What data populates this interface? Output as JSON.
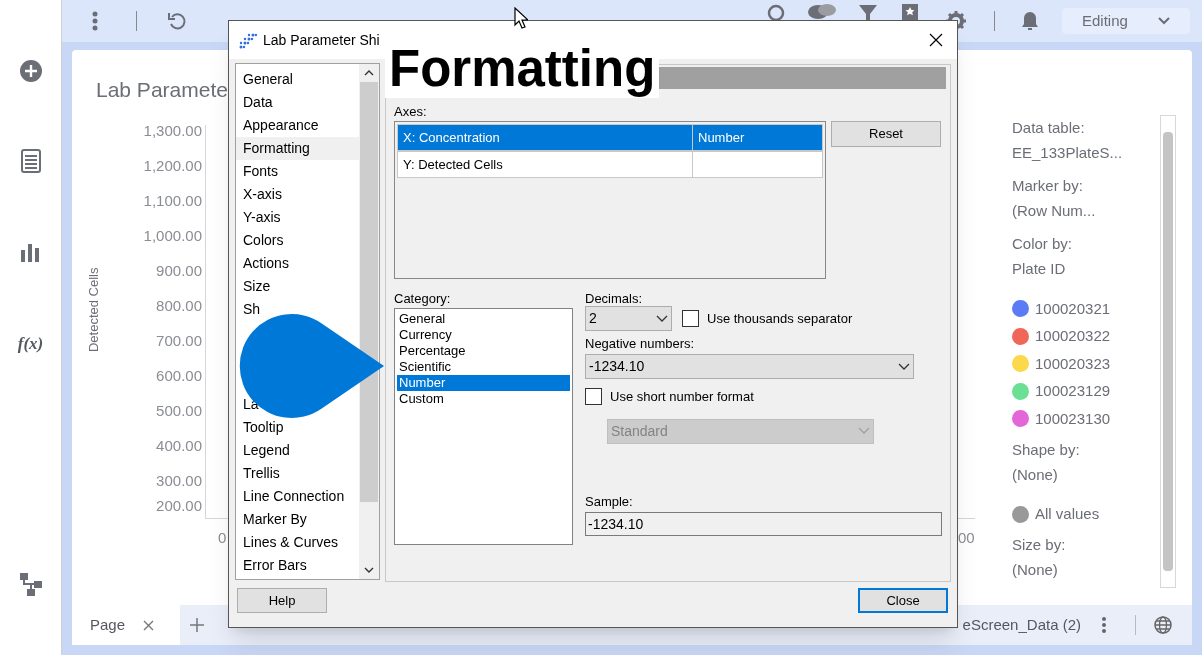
{
  "toolbar": {
    "mode": "Editing"
  },
  "sidebar": {
    "function_label": "f(x)"
  },
  "page_title": "Lab Paramete",
  "chart": {
    "ylabel": "Detected Cells",
    "yticks": [
      "1,300.00",
      "1,200.00",
      "1,100.00",
      "1,000.00",
      "900.00",
      "800.00",
      "700.00",
      "600.00",
      "500.00",
      "400.00",
      "300.00",
      "200.00"
    ],
    "xticks": [
      "0",
      "00"
    ]
  },
  "legend": [
    {
      "label": "Data table:",
      "value": "EE_133PlateS..."
    },
    {
      "label": "Marker by:",
      "value": "(Row Num..."
    },
    {
      "label": "Color by:",
      "value": "Plate ID",
      "items": [
        {
          "text": "100020321",
          "color": "#5b7cf5"
        },
        {
          "text": "100020322",
          "color": "#f0675a"
        },
        {
          "text": "100020323",
          "color": "#fcd94a"
        },
        {
          "text": "100023129",
          "color": "#6bdf94"
        },
        {
          "text": "100023130",
          "color": "#e467d9"
        }
      ]
    },
    {
      "label": "Shape by:",
      "value": "(None)",
      "items": [
        {
          "text": "All values",
          "color": "#999999"
        }
      ]
    },
    {
      "label": "Size by:",
      "value": "(None)"
    }
  ],
  "tabs": [
    {
      "label": "Page",
      "selected": true
    }
  ],
  "status": "eScreen_Data (2)",
  "dialog": {
    "title": "Lab Parameter Shi",
    "pages_top": [
      {
        "label": "General",
        "selected": false
      },
      {
        "label": "Data",
        "selected": false
      },
      {
        "label": "Appearance",
        "selected": false
      },
      {
        "label": "Formatting",
        "selected": true
      },
      {
        "label": "Fonts",
        "selected": false
      },
      {
        "label": "X-axis",
        "selected": false
      },
      {
        "label": "Y-axis",
        "selected": false
      },
      {
        "label": "Colors",
        "selected": false
      },
      {
        "label": "Actions",
        "selected": false
      },
      {
        "label": "Size",
        "selected": false
      },
      {
        "label": "Sh",
        "selected": false
      }
    ],
    "pages_bottom": [
      {
        "label": "La",
        "selected": false
      },
      {
        "label": "Tooltip",
        "selected": false
      },
      {
        "label": "Legend",
        "selected": false
      },
      {
        "label": "Trellis",
        "selected": false
      },
      {
        "label": "Line Connection",
        "selected": false
      },
      {
        "label": "Marker By",
        "selected": false
      },
      {
        "label": "Lines & Curves",
        "selected": false
      },
      {
        "label": "Error Bars",
        "selected": false
      }
    ],
    "axes_label": "Axes:",
    "axes": [
      {
        "name": "X: Concentration",
        "format": "Number",
        "selected": true
      },
      {
        "name": "Y: Detected Cells",
        "selected": false
      }
    ],
    "reset": "Reset",
    "category_label": "Category:",
    "categories": [
      {
        "label": "General",
        "selected": false
      },
      {
        "label": "Currency",
        "selected": false
      },
      {
        "label": "Percentage",
        "selected": false
      },
      {
        "label": "Scientific",
        "selected": false
      },
      {
        "label": "Number",
        "selected": true
      },
      {
        "label": "Custom",
        "selected": false
      }
    ],
    "decimals_label": "Decimals:",
    "decimals": "2",
    "thousands": {
      "label": "Use thousands separator",
      "checked": false
    },
    "negative_label": "Negative numbers:",
    "negative": "-1234.10",
    "short_format": {
      "label": "Use short number format",
      "checked": false
    },
    "short_style": {
      "value": "Standard",
      "disabled": true
    },
    "sample_label": "Sample:",
    "sample": "-1234.10",
    "help": "Help",
    "close": "Close"
  },
  "overlay": {
    "caption": "Formatting"
  }
}
